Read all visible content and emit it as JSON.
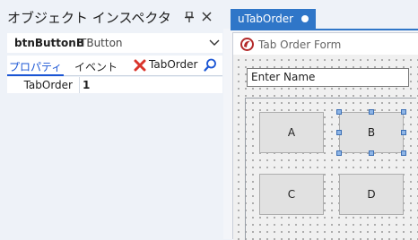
{
  "inspector": {
    "title": "オブジェクト インスペクタ",
    "selected_component": {
      "name": "btnButtonB",
      "type": "TButton"
    },
    "tabs": [
      {
        "label": "プロパティ",
        "active": true
      },
      {
        "label": "イベント",
        "active": false
      }
    ],
    "search_text": "TabOrder",
    "properties": [
      {
        "name": "TabOrder",
        "value": "1"
      }
    ],
    "icons": {
      "pin": "pin-icon",
      "close": "close-icon",
      "clear": "clear-x-icon",
      "search": "search-icon",
      "dropdown": "chevron-down-icon"
    },
    "colors": {
      "accent": "#1a55d4",
      "clear": "#d9342b"
    }
  },
  "designer": {
    "tab_label": "uTabOrder",
    "tab_color": "#2f76c8",
    "form": {
      "title": "Tab Order Form",
      "edit_placeholder": "Enter Name",
      "buttons": [
        {
          "label": "A",
          "selected": false
        },
        {
          "label": "B",
          "selected": true
        },
        {
          "label": "C",
          "selected": false
        },
        {
          "label": "D",
          "selected": false
        }
      ]
    }
  }
}
